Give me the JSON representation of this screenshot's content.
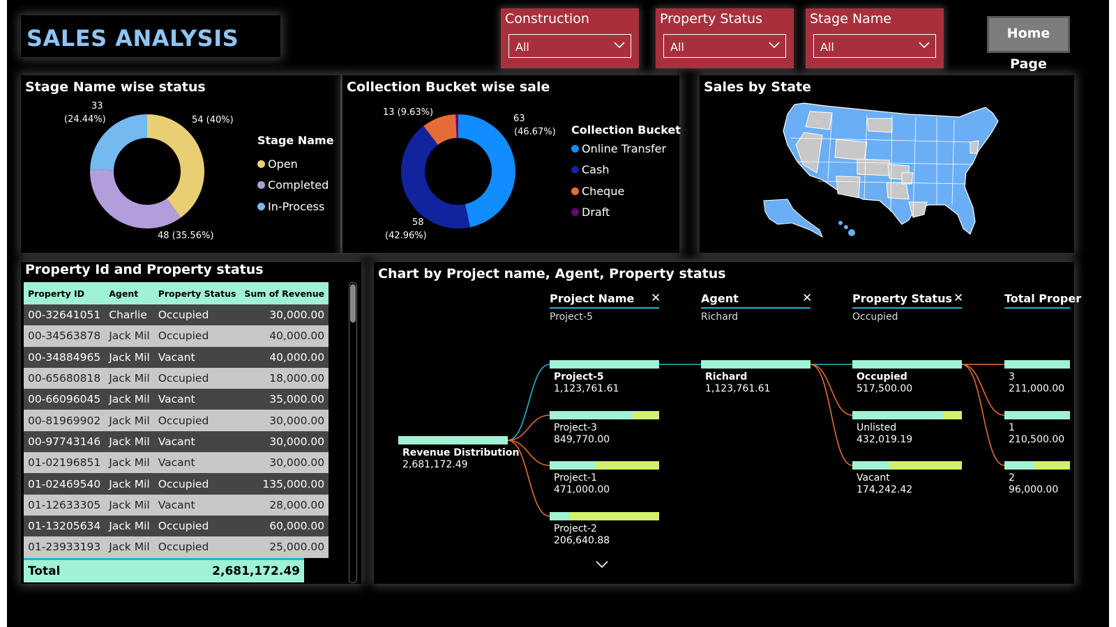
{
  "header": {
    "title": "SALES ANALYSIS",
    "slicers": [
      {
        "label": "Construction",
        "value": "All"
      },
      {
        "label": "Property Status",
        "value": "All"
      },
      {
        "label": "Stage Name",
        "value": "All"
      }
    ],
    "home_button": "Home Page"
  },
  "stage_chart": {
    "title": "Stage Name wise status",
    "legend_title": "Stage Name",
    "labels": [
      "54 (40%)",
      "48 (35.56%)",
      "33",
      "(24.44%)"
    ],
    "chart_data": {
      "type": "pie",
      "categories": [
        "Open",
        "Completed",
        "In-Process"
      ],
      "values": [
        54,
        48,
        33
      ],
      "colors": [
        "#e9ce74",
        "#b39ddb",
        "#74b9f0"
      ]
    }
  },
  "bucket_chart": {
    "title": "Collection Bucket wise sale",
    "legend_title": "Collection Bucket",
    "labels": [
      "63",
      "(46.67%)",
      "58",
      "(42.96%)",
      "13 (9.63%)"
    ],
    "chart_data": {
      "type": "pie",
      "categories": [
        "Online Transfer",
        "Cash",
        "Cheque",
        "Draft"
      ],
      "values": [
        63,
        58,
        13,
        1
      ],
      "colors": [
        "#118dff",
        "#12239e",
        "#e66c37",
        "#6b007b"
      ]
    }
  },
  "map": {
    "title": "Sales by State",
    "colors": {
      "highlighted": "#6aaef5",
      "other": "#c8c8c8"
    }
  },
  "table": {
    "title": "Property Id and Property status",
    "columns": [
      "Property ID",
      "Agent",
      "Property Status",
      "Sum of Revenue"
    ],
    "rows": [
      [
        "00-32641051",
        "Charlie",
        "Occupied",
        "30,000.00"
      ],
      [
        "00-34563878",
        "Jack Mil",
        "Occupied",
        "40,000.00"
      ],
      [
        "00-34884965",
        "Jack Mil",
        "Vacant",
        "40,000.00"
      ],
      [
        "00-65680818",
        "Jack Mil",
        "Occupied",
        "18,000.00"
      ],
      [
        "00-66096045",
        "Jack Mil",
        "Vacant",
        "35,000.00"
      ],
      [
        "00-81969902",
        "Jack Mil",
        "Occupied",
        "30,000.00"
      ],
      [
        "00-97743146",
        "Jack Mil",
        "Vacant",
        "30,000.00"
      ],
      [
        "01-02196851",
        "Jack Mil",
        "Vacant",
        "30,000.00"
      ],
      [
        "01-02469540",
        "Jack Mil",
        "Occupied",
        "135,000.00"
      ],
      [
        "01-12633305",
        "Jack Mil",
        "Vacant",
        "28,000.00"
      ],
      [
        "01-13205634",
        "Jack Mil",
        "Occupied",
        "60,000.00"
      ],
      [
        "01-23933193",
        "Jack Mil",
        "Occupied",
        "25,000.00"
      ]
    ],
    "total_label": "Total",
    "total_value": "2,681,172.49"
  },
  "decomp": {
    "title": "Chart by Project name, Agent, Property status",
    "columns": [
      {
        "head": "Project Name",
        "sub": "Project-5"
      },
      {
        "head": "Agent",
        "sub": "Richard"
      },
      {
        "head": "Property Status",
        "sub": "Occupied"
      },
      {
        "head": "Total Proper",
        "sub": ""
      }
    ],
    "root": {
      "name": "Revenue Distribution",
      "value": "2,681,172.49",
      "fraction": 1.0
    },
    "projects": [
      {
        "name": "Project-5",
        "value": "1,123,761.61",
        "fraction": 1.0,
        "selected": true
      },
      {
        "name": "Project-3",
        "value": "849,770.00",
        "fraction": 0.756
      },
      {
        "name": "Project-1",
        "value": "471,000.00",
        "fraction": 0.419
      },
      {
        "name": "Project-2",
        "value": "206,640.88",
        "fraction": 0.184
      }
    ],
    "agents": [
      {
        "name": "Richard",
        "value": "1,123,761.61",
        "fraction": 1.0,
        "selected": true
      }
    ],
    "statuses": [
      {
        "name": "Occupied",
        "value": "517,500.00",
        "fraction": 1.0,
        "selected": true
      },
      {
        "name": "Unlisted",
        "value": "432,019.19",
        "fraction": 0.835
      },
      {
        "name": "Vacant",
        "value": "174,242.42",
        "fraction": 0.337
      }
    ],
    "totals": [
      {
        "name": "3",
        "value": "211,000.00",
        "fraction": 1.0
      },
      {
        "name": "1",
        "value": "210,500.00",
        "fraction": 0.998
      },
      {
        "name": "2",
        "value": "96,000.00",
        "fraction": 0.455
      }
    ]
  }
}
